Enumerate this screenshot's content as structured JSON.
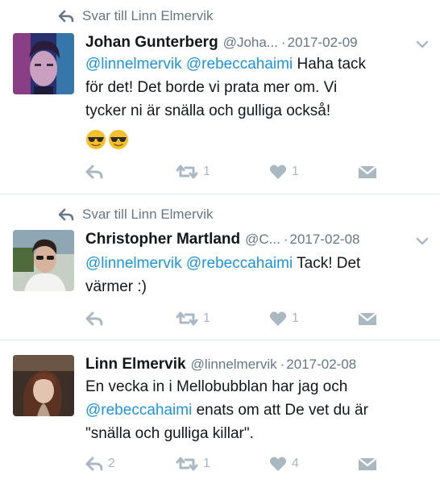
{
  "tweets": [
    {
      "reply_context": "Svar till Linn Elmervik",
      "name": "Johan Gunterberg",
      "handle": "@Joha...",
      "separator": "·",
      "date": "2017-02-09",
      "text_mention_1": "@linnelmervik",
      "text_mention_2": "@rebeccahaimi",
      "text_line_1": "Haha tack",
      "text_line_2": "för det! Det borde vi prata mer om. Vi",
      "text_line_3": "tycker ni är snälla och gulliga också!",
      "emoji": [
        "sunglasses-emoji",
        "sunglasses-emoji"
      ],
      "retweet_count": "1",
      "like_count": "1"
    },
    {
      "reply_context": "Svar till Linn Elmervik",
      "name": "Christopher Martland",
      "handle": "@C...",
      "separator": "·",
      "date": "2017-02-08",
      "text_mention_1": "@linnelmervik",
      "text_mention_2": "@rebeccahaimi",
      "text_line_1": "Tack! Det",
      "text_line_2": "värmer :)",
      "retweet_count": "1",
      "like_count": "1"
    },
    {
      "name": "Linn Elmervik",
      "handle": "@linnelmervik",
      "separator": "·",
      "date": "2017-02-08",
      "text_line_1": "En vecka in i Mellobubblan har jag och",
      "text_mention_1": "@rebeccahaimi",
      "text_line_2": "enats om att De vet du är",
      "text_line_3": "\"snälla och gulliga killar\".",
      "reply_count": "2",
      "retweet_count": "1",
      "like_count": "4"
    }
  ],
  "colors": {
    "link": "#1b95e0",
    "secondary_text": "#657786",
    "action_icon": "#aab8c2",
    "divider": "#e1e8ed"
  },
  "icons": [
    "reply-icon",
    "retweet-icon",
    "like-icon",
    "message-icon",
    "chevron-down-icon"
  ]
}
